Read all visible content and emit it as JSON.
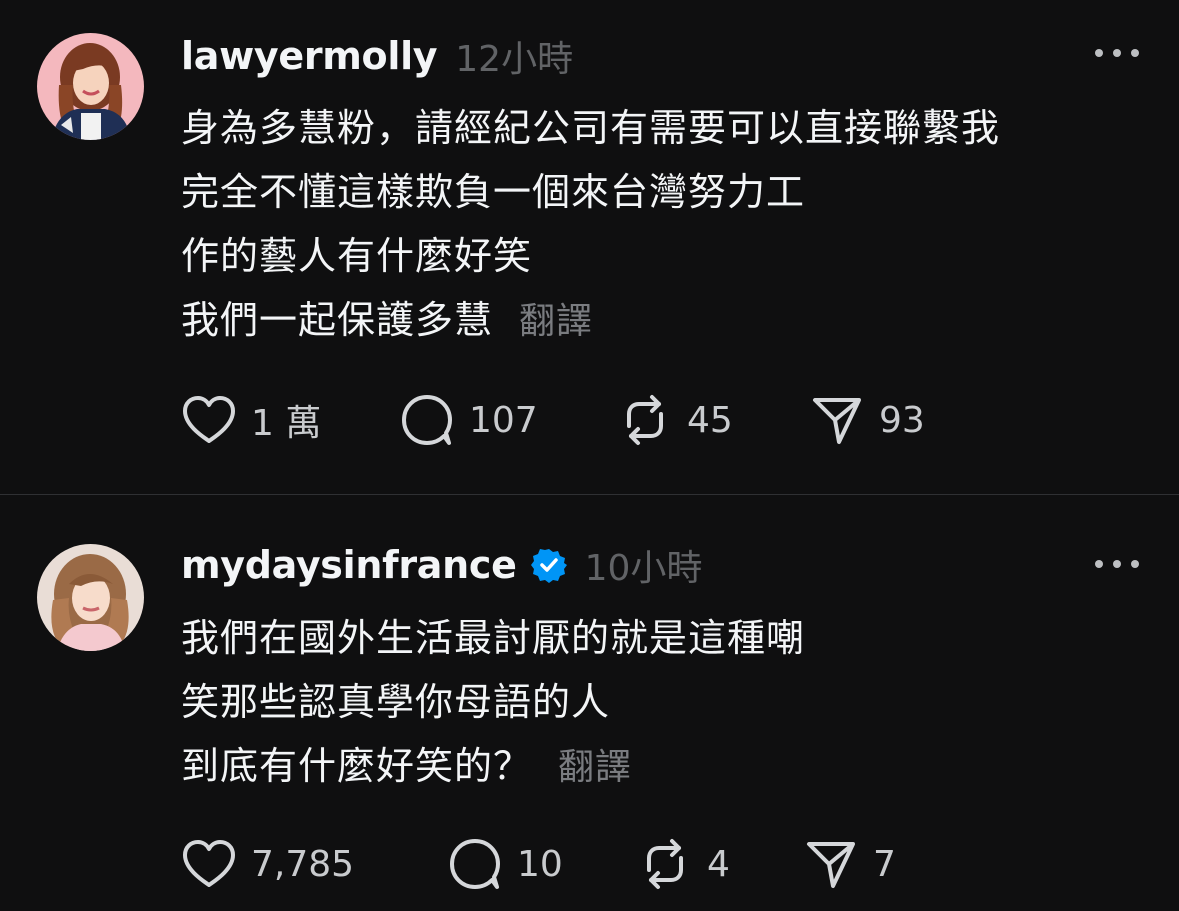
{
  "posts": [
    {
      "username": "lawyermolly",
      "verified": false,
      "time": "12小時",
      "lines": [
        "身為多慧粉，請經紀公司有需要可以直接聯繫我",
        "完全不懂這樣欺負一個來台灣努力工",
        "作的藝人有什麼好笑",
        "我們一起保護多慧"
      ],
      "translate": "翻譯",
      "likes": "1 萬",
      "replies": "107",
      "reposts": "45",
      "shares": "93"
    },
    {
      "username": "mydaysinfrance",
      "verified": true,
      "time": "10小時",
      "lines": [
        "我們在國外生活最討厭的就是這種嘲",
        "笑那些認真學你母語的人",
        "到底有什麼好笑的？"
      ],
      "translate": "翻譯",
      "likes": "7,785",
      "replies": "10",
      "reposts": "4",
      "shares": "7"
    }
  ],
  "icons": {
    "like": "heart-icon",
    "reply": "speech-bubble-icon",
    "repost": "repost-icon",
    "share": "send-icon",
    "more": "more-horizontal-icon",
    "verified": "verified-badge-icon"
  },
  "colors": {
    "background": "#0f0f10",
    "text": "#f3f5f7",
    "muted": "#616366",
    "verified": "#0095f6"
  }
}
